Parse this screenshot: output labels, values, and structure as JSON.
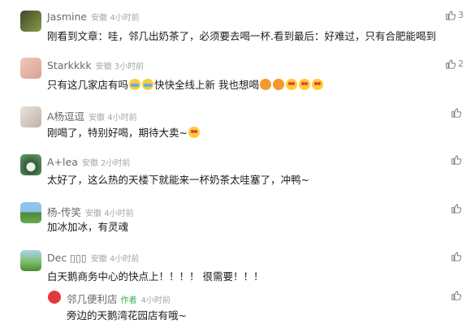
{
  "comments": [
    {
      "name": "Jasmine",
      "location": "安徽",
      "time": "4小时前",
      "text": "刚看到文章：哇，邻几出奶茶了，必须要去喝一杯.看到最后：好难过，只有合肥能喝到",
      "likes": "3"
    },
    {
      "name": "Starkkkk",
      "location": "安徽",
      "time": "3小时前",
      "text": "只有这几家店有吗",
      "text2": "快快全线上新 我也想喝",
      "likes": "2"
    },
    {
      "name": "A杨逗逗",
      "location": "安徽",
      "time": "4小时前",
      "text": "刚喝了，特别好喝，期待大卖~",
      "likes": ""
    },
    {
      "name": "A+lea",
      "location": "安徽",
      "time": "2小时前",
      "text": "太好了，这么热的天楼下就能来一杯奶茶太哇塞了，冲鸭~",
      "likes": ""
    },
    {
      "name": "杨-传笑",
      "location": "安徽",
      "time": "4小时前",
      "text": "加冰加冰，有灵魂",
      "likes": ""
    },
    {
      "name": "Dec ▯▯▯",
      "location": "安徽",
      "time": "4小时前",
      "text": "白天鹅商务中心的快点上！！！！ 很需要！！！",
      "likes": ""
    }
  ],
  "reply": {
    "name": "邻几便利店",
    "badge": "作者",
    "time": "4小时前",
    "text": "旁边的天鹅湾花园店有哦~",
    "likes": ""
  },
  "icons": {
    "like": "thumbs-up-icon"
  }
}
